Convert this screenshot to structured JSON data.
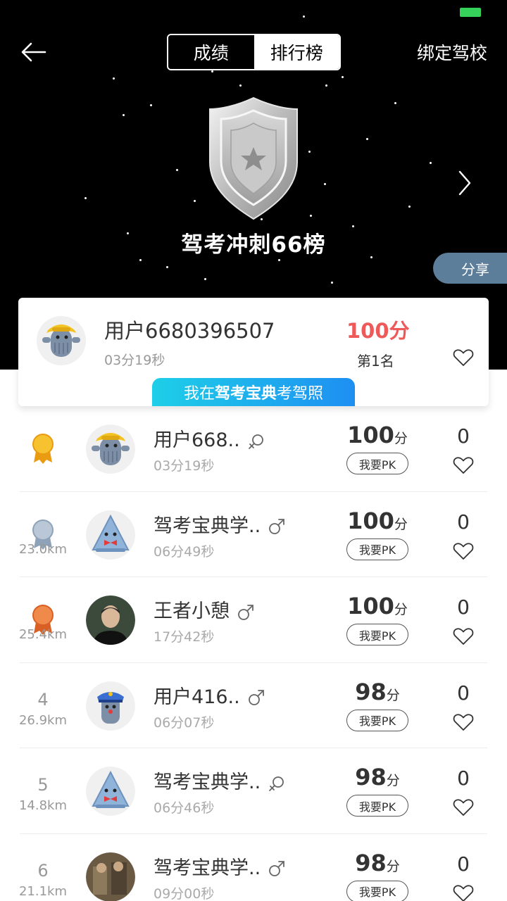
{
  "header": {
    "tabs": [
      "成绩",
      "排行榜"
    ],
    "active_tab": 0,
    "bind_school": "绑定驾校",
    "board_title": "驾考冲刺66榜",
    "share": "分享"
  },
  "my_card": {
    "name": "用户6680396507",
    "time": "03分19秒",
    "score": "100分",
    "rank": "第1名",
    "promo_prefix": "我在",
    "promo_brand": "驾考宝典",
    "promo_suffix": "考驾照"
  },
  "pk_label": "我要PK",
  "score_unit": "分",
  "rows": [
    {
      "rank": "1",
      "distance": "",
      "name": "用户668..",
      "gender": "female",
      "time": "03分19秒",
      "score": "100",
      "likes": "0",
      "avatar": "cactus-yellow",
      "medal": "gold"
    },
    {
      "rank": "2",
      "distance": "23.0km",
      "name": "驾考宝典学..",
      "gender": "male",
      "time": "06分49秒",
      "score": "100",
      "likes": "0",
      "avatar": "cone-blue",
      "medal": "silver"
    },
    {
      "rank": "3",
      "distance": "25.4km",
      "name": "王者小憩",
      "gender": "male",
      "time": "17分42秒",
      "score": "100",
      "likes": "0",
      "avatar": "photo-man",
      "medal": "bronze"
    },
    {
      "rank": "4",
      "distance": "26.9km",
      "name": "用户416..",
      "gender": "male",
      "time": "06分07秒",
      "score": "98",
      "likes": "0",
      "avatar": "police-blue",
      "medal": ""
    },
    {
      "rank": "5",
      "distance": "14.8km",
      "name": "驾考宝典学..",
      "gender": "female",
      "time": "06分46秒",
      "score": "98",
      "likes": "0",
      "avatar": "cone-blue",
      "medal": ""
    },
    {
      "rank": "6",
      "distance": "21.1km",
      "name": "驾考宝典学..",
      "gender": "male",
      "time": "09分00秒",
      "score": "98",
      "likes": "0",
      "avatar": "photo-group",
      "medal": ""
    }
  ],
  "colors": {
    "header_bg": "#000000",
    "score_red": "#ee5a5a",
    "share_bg": "#5d7e9b",
    "promo_gradient_start": "#1ecfe8",
    "promo_gradient_end": "#1e8ff2",
    "battery": "#35d15a"
  },
  "icons": {
    "back": "arrow-left-icon",
    "next": "chevron-right-icon",
    "badge": "silver-shield-star-badge",
    "like": "heart-outline-icon",
    "male": "male-symbol-icon",
    "female": "female-symbol-icon"
  }
}
